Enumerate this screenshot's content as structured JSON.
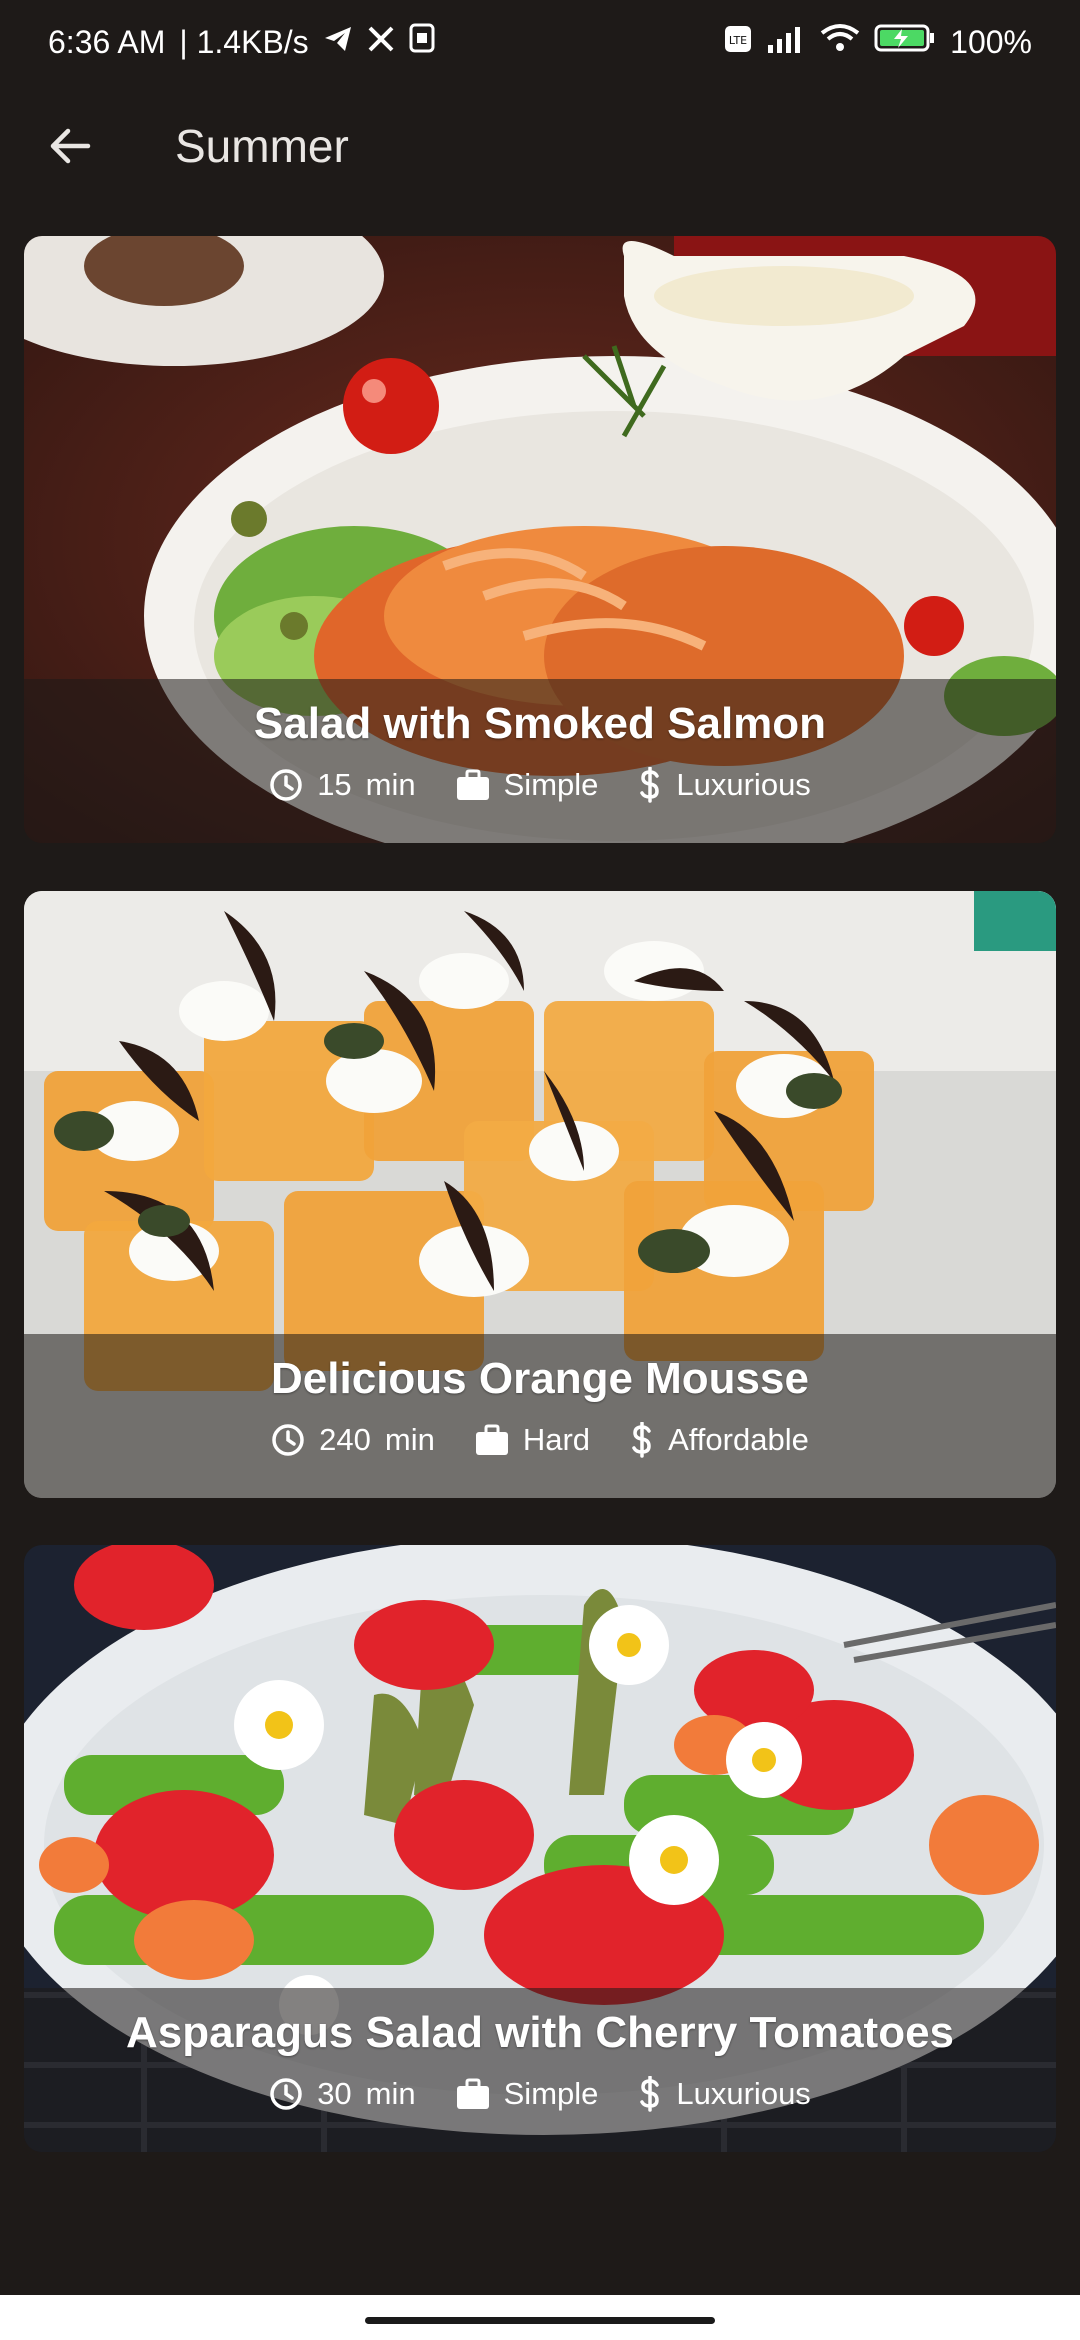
{
  "status_bar": {
    "time": "6:36 AM",
    "speed": "| 1.4KB/s",
    "battery": "100%",
    "icons": [
      "telegram-icon",
      "x-icon",
      "sim-icon",
      "volte-icon",
      "signal-icon",
      "wifi-icon",
      "battery-icon"
    ]
  },
  "app_bar": {
    "title": "Summer",
    "back_icon": "arrow-left-icon"
  },
  "meals": [
    {
      "title": "Salad with Smoked Salmon",
      "duration": "15",
      "duration_unit": "min",
      "complexity": "Simple",
      "affordability": "Luxurious"
    },
    {
      "title": "Delicious Orange Mousse",
      "duration": "240",
      "duration_unit": "min",
      "complexity": "Hard",
      "affordability": "Affordable"
    },
    {
      "title": "Asparagus Salad with Cherry Tomatoes",
      "duration": "30",
      "duration_unit": "min",
      "complexity": "Simple",
      "affordability": "Luxurious"
    }
  ],
  "colors": {
    "background": "#1e1a18",
    "overlay": "rgba(30,26,24,0.55)",
    "text": "#ffffff"
  }
}
